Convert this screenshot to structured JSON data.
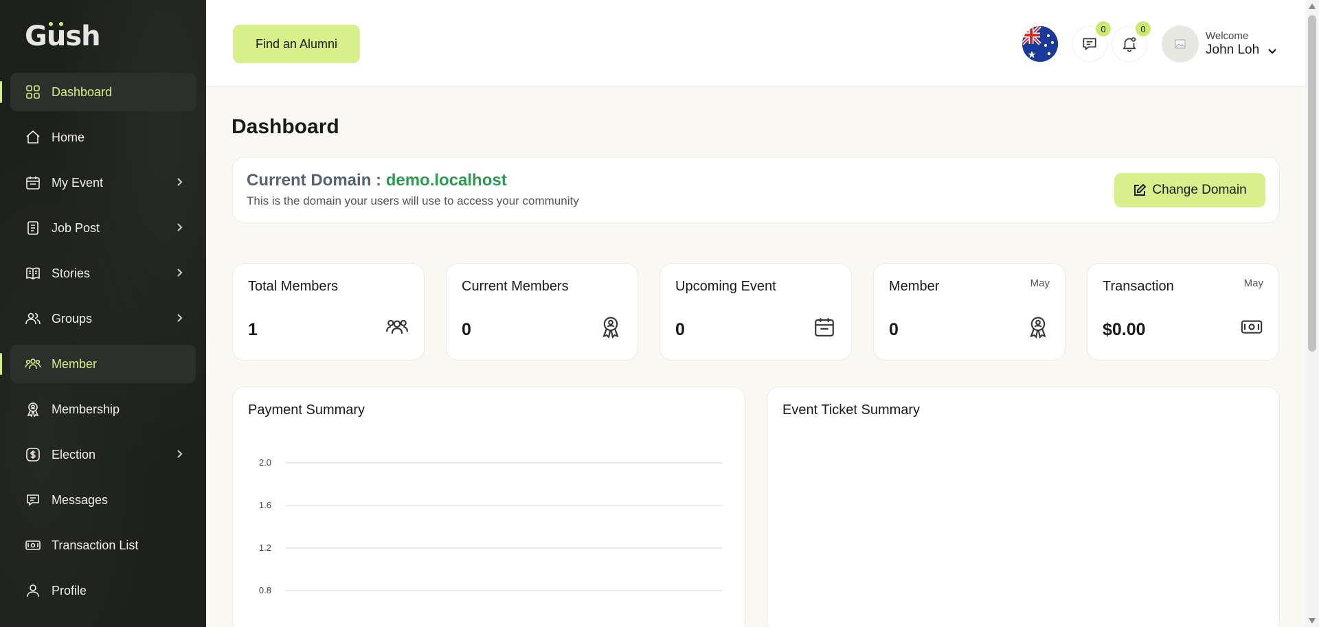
{
  "brand": {
    "logo": "Gush"
  },
  "sidebar": {
    "items": [
      {
        "label": "Dashboard",
        "icon": "grid-icon",
        "active": true,
        "chevron": false
      },
      {
        "label": "Home",
        "icon": "home-icon",
        "active": false,
        "chevron": false
      },
      {
        "label": "My Event",
        "icon": "calendar-icon",
        "active": false,
        "chevron": true
      },
      {
        "label": "Job Post",
        "icon": "document-icon",
        "active": false,
        "chevron": true
      },
      {
        "label": "Stories",
        "icon": "book-icon",
        "active": false,
        "chevron": true
      },
      {
        "label": "Groups",
        "icon": "users-icon",
        "active": false,
        "chevron": true
      },
      {
        "label": "Member",
        "icon": "members-icon",
        "active": true,
        "chevron": false
      },
      {
        "label": "Membership",
        "icon": "badge-icon",
        "active": false,
        "chevron": false
      },
      {
        "label": "Election",
        "icon": "dollar-icon",
        "active": false,
        "chevron": true
      },
      {
        "label": "Messages",
        "icon": "message-icon",
        "active": false,
        "chevron": false
      },
      {
        "label": "Transaction List",
        "icon": "money-icon",
        "active": false,
        "chevron": false
      },
      {
        "label": "Profile",
        "icon": "user-icon",
        "active": false,
        "chevron": false
      }
    ]
  },
  "topbar": {
    "find_alumni_label": "Find an Alumni",
    "messages_count": "0",
    "notifications_count": "0",
    "welcome": "Welcome",
    "username": "John Loh"
  },
  "main": {
    "title": "Dashboard",
    "domain": {
      "label": "Current Domain : ",
      "value": "demo.localhost",
      "description": "This is the domain your users will use to access your community",
      "change_label": "Change Domain"
    },
    "stats": [
      {
        "title": "Total Members",
        "value": "1",
        "month": "",
        "icon": "group-icon"
      },
      {
        "title": "Current Members",
        "value": "0",
        "month": "",
        "icon": "award-icon"
      },
      {
        "title": "Upcoming Event",
        "value": "0",
        "month": "",
        "icon": "calendar-icon"
      },
      {
        "title": "Member",
        "value": "0",
        "month": "May",
        "icon": "award-icon"
      },
      {
        "title": "Transaction",
        "value": "$0.00",
        "month": "May",
        "icon": "money-icon"
      }
    ],
    "payment_summary_title": "Payment Summary",
    "event_ticket_title": "Event Ticket Summary"
  },
  "colors": {
    "accent": "#d8f08c",
    "sidebar_bg": "#1c1f1a",
    "domain_value": "#2d9a4f"
  },
  "chart_data": {
    "type": "line",
    "title": "Payment Summary",
    "y_ticks": [
      "2.0",
      "1.6",
      "1.2",
      "0.8"
    ],
    "ylim": [
      0.8,
      2.0
    ],
    "grid": true,
    "series": []
  }
}
